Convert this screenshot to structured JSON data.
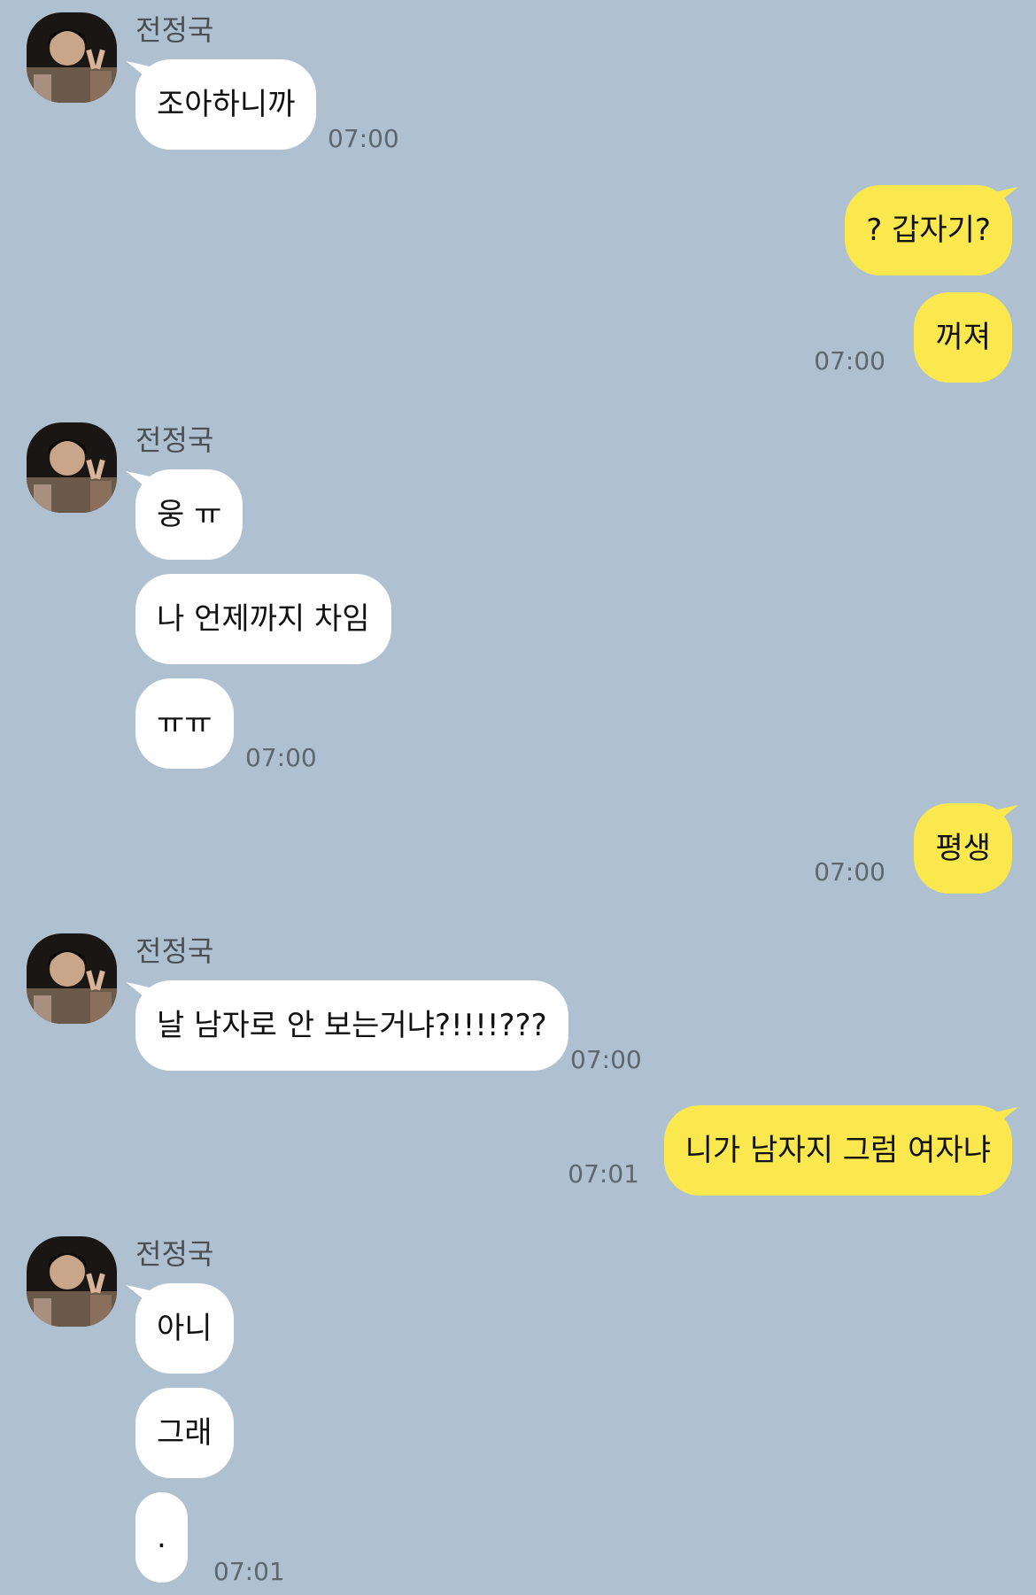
{
  "theme": {
    "background": "#afc1d0",
    "incoming_bubble": "#ffffff",
    "outgoing_bubble": "#fae84e"
  },
  "contact": {
    "name": "전정국",
    "avatar_icon": "profile-photo-icon"
  },
  "messages": [
    {
      "direction": "in",
      "text": "조아하니까",
      "time": "07:00"
    },
    {
      "direction": "out",
      "text": "? 갑자기?",
      "time": ""
    },
    {
      "direction": "out",
      "text": "꺼져",
      "time": "07:00"
    },
    {
      "direction": "in",
      "text": "웅 ㅠ",
      "time": ""
    },
    {
      "direction": "in",
      "text": "나 언제까지 차임",
      "time": ""
    },
    {
      "direction": "in",
      "text": "ㅠㅠ",
      "time": "07:00"
    },
    {
      "direction": "out",
      "text": "평생",
      "time": "07:00"
    },
    {
      "direction": "in",
      "text": "날 남자로 안 보는거냐?!!!!???",
      "time": "07:00"
    },
    {
      "direction": "out",
      "text": "니가 남자지 그럼 여자냐",
      "time": "07:01"
    },
    {
      "direction": "in",
      "text": "아니",
      "time": ""
    },
    {
      "direction": "in",
      "text": "그래",
      "time": ""
    },
    {
      "direction": "in",
      "text": ".",
      "time": "07:01"
    }
  ]
}
